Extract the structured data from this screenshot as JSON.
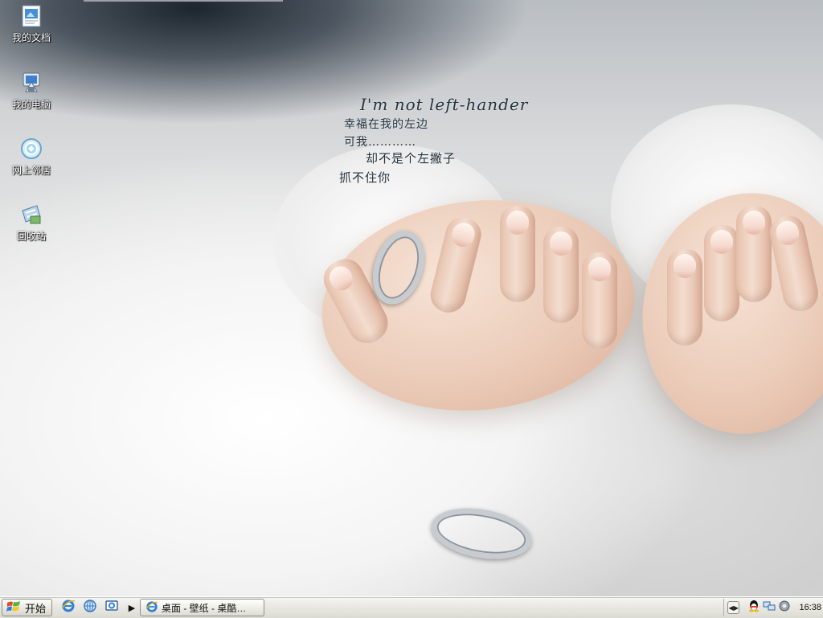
{
  "desktop": {
    "icons": [
      {
        "label": "我的文档",
        "icon": "my-documents-icon"
      },
      {
        "label": "我的电脑",
        "icon": "my-computer-icon"
      },
      {
        "label": "网上邻居",
        "icon": "network-places-icon"
      },
      {
        "label": "回收站",
        "icon": "recycle-bin-icon"
      }
    ],
    "wallpaper": {
      "line1": "I'm not left-hander",
      "line2": "幸福在我的左边",
      "line3": "可我…………",
      "line4": "却不是个左撇子",
      "line5": "抓不住你"
    }
  },
  "taskbar": {
    "start_label": "开始",
    "quick_launch": [
      {
        "icon": "internet-explorer-icon"
      },
      {
        "icon": "web-browser-icon"
      },
      {
        "icon": "show-desktop-icon"
      }
    ],
    "more_arrow_icon": "chevron-right-icon",
    "task_button_label": "桌面 - 壁纸 - 桌酷…",
    "tray": {
      "collapse_icon": "tray-expand-icon",
      "icons": [
        "qq-icon",
        "network-icon",
        "volume-icon"
      ],
      "clock": "16:38"
    }
  },
  "colors": {
    "taskbar_top": "#f6f6f3",
    "taskbar_bottom": "#dcdbd3",
    "icon_label": "#ffffff",
    "handwriting": "#23333f"
  }
}
